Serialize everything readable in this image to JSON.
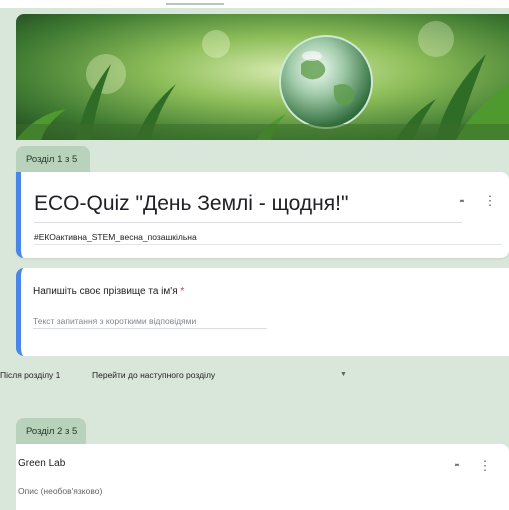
{
  "header": {
    "image_description_icon": "globe-fern-banner"
  },
  "sections": [
    {
      "tab_label": "Розділ 1 з 5",
      "title": "ECO-Quiz \"День Землі - щодня!\"",
      "description": "#ЕКОактивна_STEM_весна_позашкільна"
    },
    {
      "tab_label": "Розділ 2 з 5",
      "title": "Green Lab",
      "description": "Опис (необов'язково)"
    }
  ],
  "question": {
    "title": "Напишіть своє прізвище та ім'я",
    "required_mark": "*",
    "answer_placeholder": "Текст запитання з короткими відповідями"
  },
  "after_section": {
    "label": "Після розділу 1",
    "selected": "Перейти до наступного розділу"
  },
  "icons": {
    "collapse": "collapse-icon",
    "more": "more-vert-icon",
    "dropdown": "dropdown-arrow-icon"
  },
  "colors": {
    "background": "#d9e6da",
    "accent": "#4a86e8",
    "tab": "#b9d2bb",
    "required": "#d93025"
  }
}
